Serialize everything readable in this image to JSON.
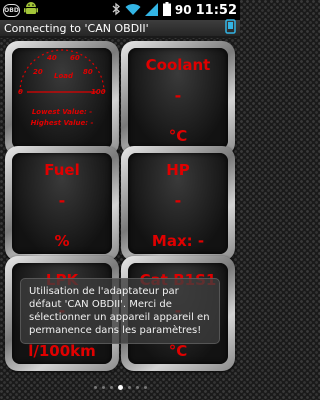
{
  "status_bar": {
    "app_icon_label": "OBD",
    "battery_percent": "90",
    "time": "11:52"
  },
  "title_bar": {
    "title": "Connecting to 'CAN OBDII'",
    "layout_icon": "tablet-icon"
  },
  "gauges": [
    {
      "kind": "dial",
      "dial_scale": [
        "0",
        "20",
        "40",
        "60",
        "80",
        "100"
      ],
      "dial_label": "Load",
      "lowest_label": "Lowest Value: -",
      "highest_label": "Highest Value: -"
    },
    {
      "label": "Coolant",
      "value": "-",
      "unit": "°C"
    },
    {
      "label": "Fuel",
      "value": "-",
      "unit": "%"
    },
    {
      "label": "HP",
      "value": "-",
      "unit": "Max: -"
    },
    {
      "label": "LPK",
      "value": "-",
      "unit": "l/100km"
    },
    {
      "label": "Cat B1S1",
      "value": "-",
      "unit": "°C"
    }
  ],
  "toast": {
    "message": "Utilisation de l'adaptateur par défaut 'CAN OBDII'. Merci de sélectionner un appareil appareil en permanence dans les paramètres!"
  },
  "pager": {
    "pages": 7,
    "active_page": 4
  },
  "colors": {
    "gauge_text": "#e00000",
    "status_bar_bg": "#000000",
    "title_bar_bg": "#2e2e2e",
    "toast_bg": "#3c3c3c"
  }
}
